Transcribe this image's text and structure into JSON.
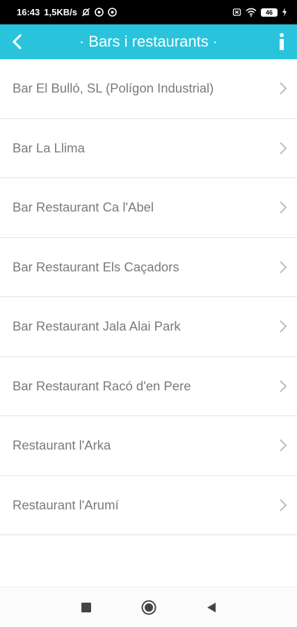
{
  "status_bar": {
    "time": "16:43",
    "speed": "1,5KB/s",
    "battery": "46"
  },
  "header": {
    "title": "· Bars i restaurants ·"
  },
  "list": {
    "items": [
      {
        "label": "Bar El Bulló, SL (Polígon Industrial)"
      },
      {
        "label": "Bar La Llima"
      },
      {
        "label": "Bar Restaurant Ca l'Abel"
      },
      {
        "label": "Bar Restaurant Els Caçadors"
      },
      {
        "label": "Bar Restaurant Jala Alai Park"
      },
      {
        "label": "Bar Restaurant Racó d'en Pere"
      },
      {
        "label": "Restaurant l'Arka"
      },
      {
        "label": "Restaurant l'Arumí"
      }
    ]
  },
  "icons": {
    "back": "chevron-left-icon",
    "info": "info-icon",
    "row": "chevron-right-icon",
    "nav_recents": "square-icon",
    "nav_home": "circle-icon",
    "nav_back": "triangle-back-icon"
  },
  "colors": {
    "accent": "#29c4dc",
    "row_text": "#7a7a7a",
    "divider": "#e2e2e2"
  }
}
